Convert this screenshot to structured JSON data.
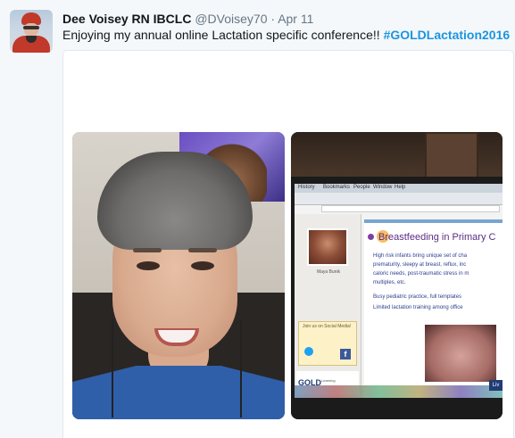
{
  "tweet": {
    "author_name": "Dee Voisey RN IBCLC",
    "handle": "@DVoisey70",
    "separator": "·",
    "date": "Apr 11",
    "text_plain": "Enjoying my annual online Lactation specific conference!! ",
    "hashtag": "#GOLDLactation2016"
  },
  "media": {
    "photos": [
      {
        "subject": "selfie-woman-gray-hair"
      },
      {
        "subject": "monitor-webinar-slide"
      }
    ],
    "slide": {
      "title": "Breastfeeding in Primary C",
      "bullets": [
        "High risk infants bring unique set of cha",
        "prematurity, sleepy at breast, reflux, inc",
        "caloric needs, post-traumatic stress in m",
        "multiples, etc.",
        "Busy pediatric practice, full templates",
        "Limited lactation training among office"
      ],
      "speaker_name": "Maya Bunik",
      "social_title": "Join us on Social Media!",
      "gold_logo": "GOLD",
      "gold_subtitle": "Learning",
      "live_badge": "Liv"
    },
    "menu_items": [
      "History",
      "Bookmarks",
      "People",
      "Window",
      "Help"
    ]
  },
  "colors": {
    "hashtag": "#1b95e0",
    "handle": "#657786",
    "background": "#f5f8fa"
  }
}
